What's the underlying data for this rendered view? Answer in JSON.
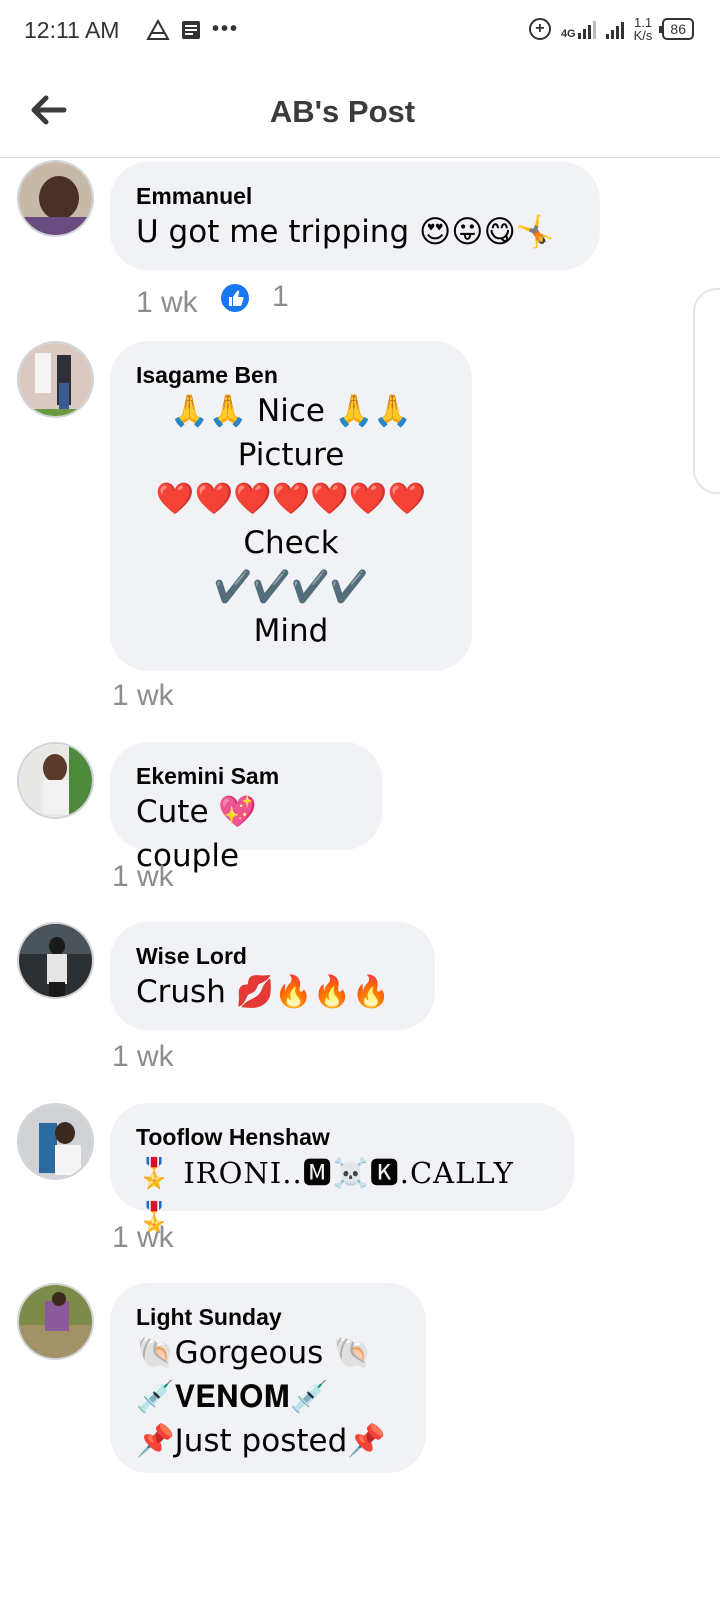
{
  "status_bar": {
    "time": "12:11 AM",
    "left_icons": [
      "alert-triangle-icon",
      "message-icon",
      "more-dots-icon"
    ],
    "network_label": "4G",
    "speed_value": "1.1",
    "speed_unit": "K/s",
    "battery": "86"
  },
  "header": {
    "title": "AB's Post",
    "back_icon": "back-arrow-icon"
  },
  "comments": [
    {
      "author": "Emmanuel",
      "text": "U got me tripping 😍😛😋🤸",
      "time": "1 wk",
      "likes": "1"
    },
    {
      "author": "Isagame Ben",
      "text": "🙏🙏 Nice 🙏🙏\nPicture\n❤️❤️❤️❤️❤️❤️❤️\nCheck\n✔️✔️✔️✔️\nMind",
      "time": "1 wk"
    },
    {
      "author": "Ekemini Sam",
      "text": "Cute 💖couple",
      "time": "1 wk"
    },
    {
      "author": "Wise Lord",
      "text": "Crush 💋🔥🔥🔥",
      "time": "1 wk"
    },
    {
      "author": "Tooflow Henshaw",
      "text": "🎖️ IRONI..🅼☠️🅺.CALLY🎖️",
      "time": "1 wk"
    },
    {
      "author": "Light Sunday",
      "text": "🐚Gorgeous 🐚\n💉𝐕𝐄𝐍𝐎𝐌💉\n📌Just posted📌"
    }
  ],
  "colors": {
    "bubble": "#f0f2f5",
    "meta": "#8a8d91",
    "like_blue": "#1877f2"
  }
}
